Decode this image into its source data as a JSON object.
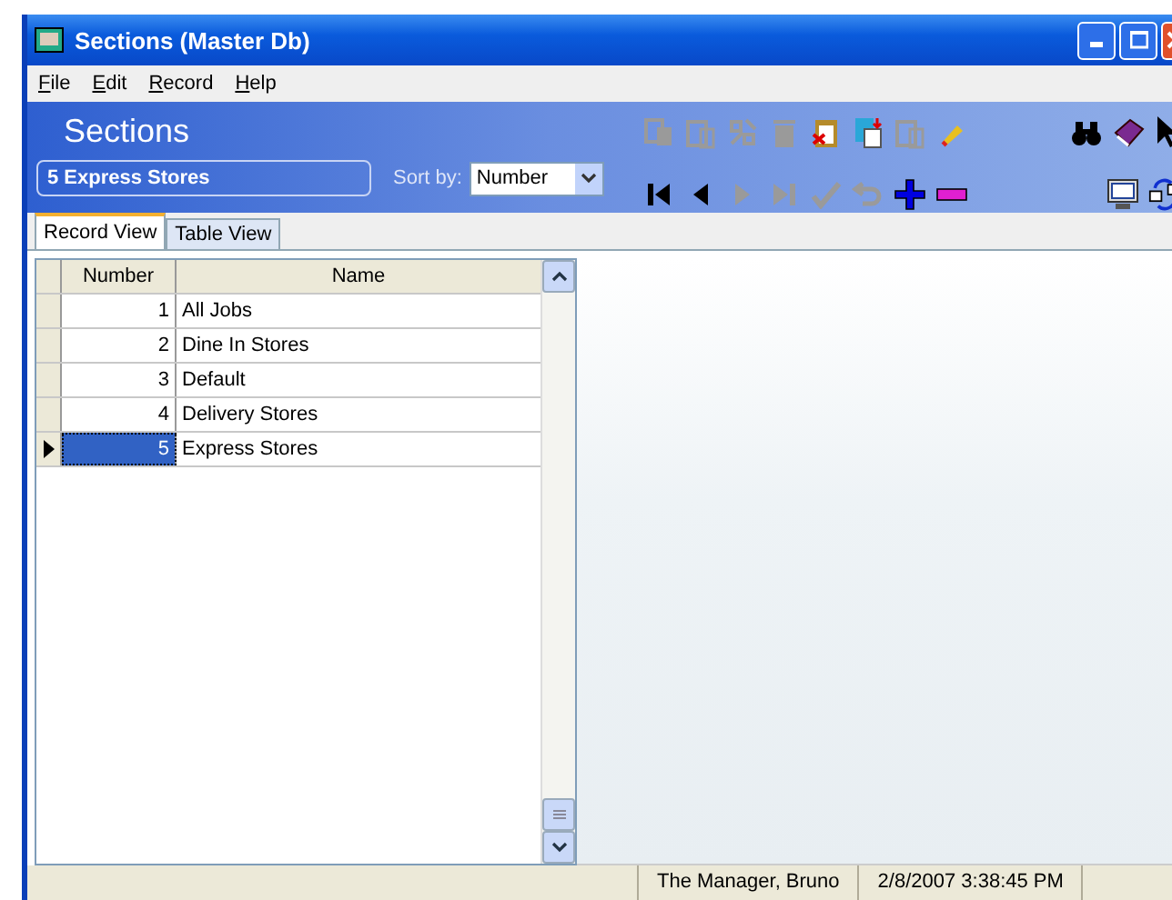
{
  "window": {
    "title": "Sections (Master Db)"
  },
  "menu": [
    {
      "label": "File"
    },
    {
      "label": "Edit"
    },
    {
      "label": "Record"
    },
    {
      "label": "Help"
    }
  ],
  "header": {
    "title": "Sections",
    "current_record": "5 Express Stores",
    "sort_label": "Sort by:",
    "sort_value": "Number"
  },
  "toolbar_top": [
    {
      "kind": "copy",
      "disabled": true
    },
    {
      "kind": "paste",
      "disabled": true
    },
    {
      "kind": "tool",
      "disabled": true
    },
    {
      "kind": "trash",
      "disabled": true
    },
    {
      "kind": "clipboard",
      "disabled": false
    },
    {
      "kind": "document",
      "disabled": false
    },
    {
      "kind": "paste",
      "disabled": true
    },
    {
      "kind": "pencil",
      "disabled": false
    }
  ],
  "toolbar_nav": [
    {
      "kind": "first",
      "disabled": false
    },
    {
      "kind": "prev",
      "disabled": false
    },
    {
      "kind": "next",
      "disabled": true
    },
    {
      "kind": "last",
      "disabled": true
    },
    {
      "kind": "check",
      "disabled": true
    },
    {
      "kind": "undo",
      "disabled": true
    },
    {
      "kind": "plus",
      "disabled": false
    },
    {
      "kind": "minus",
      "disabled": false
    }
  ],
  "tools_right_top": [
    {
      "kind": "binoculars"
    },
    {
      "kind": "book"
    },
    {
      "kind": "help"
    }
  ],
  "tools_right_bottom": [
    {
      "kind": "monitor"
    },
    {
      "kind": "sync"
    }
  ],
  "tabs": [
    {
      "label": "Record View",
      "selected": true
    },
    {
      "label": "Table View",
      "selected": false
    }
  ],
  "table": {
    "columns": [
      "Number",
      "Name"
    ],
    "rows": [
      {
        "number": "1",
        "name": "All Jobs",
        "selected": false
      },
      {
        "number": "2",
        "name": "Dine In Stores",
        "selected": false
      },
      {
        "number": "3",
        "name": "Default",
        "selected": false
      },
      {
        "number": "4",
        "name": "Delivery Stores",
        "selected": false
      },
      {
        "number": "5",
        "name": "Express Stores",
        "selected": true
      }
    ]
  },
  "status_bar": [
    "The Manager, Bruno",
    "2/8/2007 3:38:45 PM"
  ]
}
